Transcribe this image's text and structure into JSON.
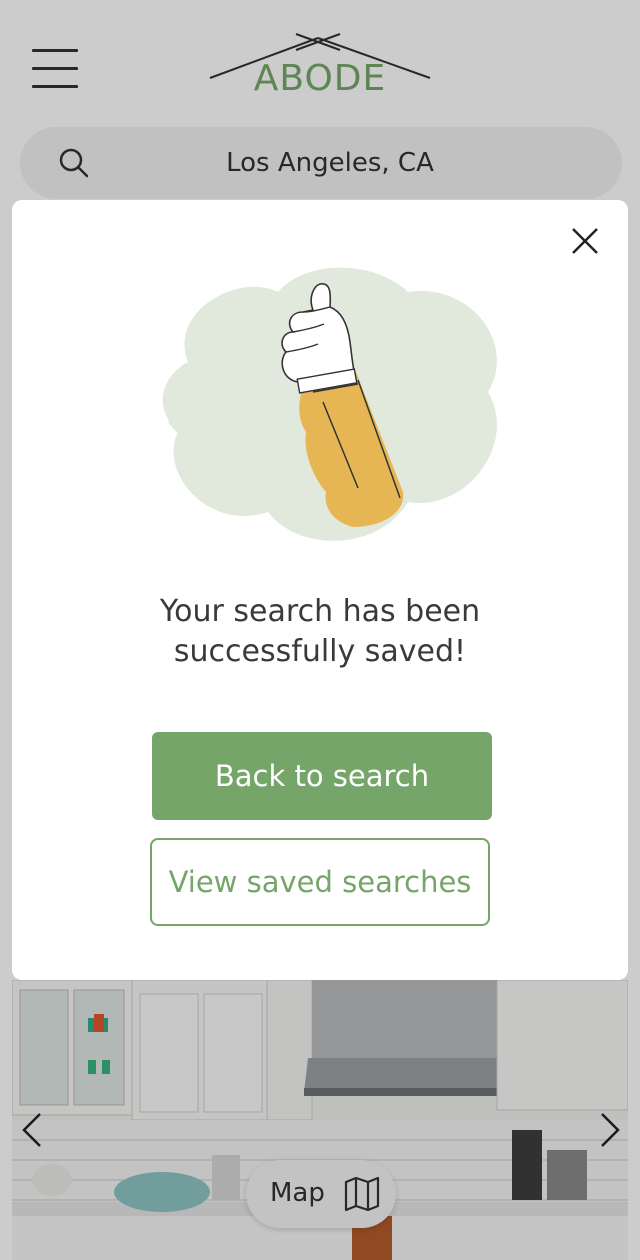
{
  "header": {
    "logo_text": "ABODE",
    "menu_icon": "hamburger-menu-icon"
  },
  "search": {
    "value": "Los Angeles, CA",
    "icon": "search-icon"
  },
  "listing": {
    "photo_description_icon": "kitchen-photo",
    "prev_icon": "chevron-left-icon",
    "next_icon": "chevron-right-icon"
  },
  "map_button": {
    "label": "Map",
    "icon": "map-icon"
  },
  "modal": {
    "title": "Your search has been successfully saved!",
    "primary_button": "Back to search",
    "secondary_button": "View saved searches",
    "close_icon": "close-icon",
    "illustration_icon": "thumbs-up-icon"
  },
  "colors": {
    "brand_green": "#76a56a",
    "illustration_sleeve": "#e6b655",
    "illustration_blob": "#e1e9dd"
  }
}
